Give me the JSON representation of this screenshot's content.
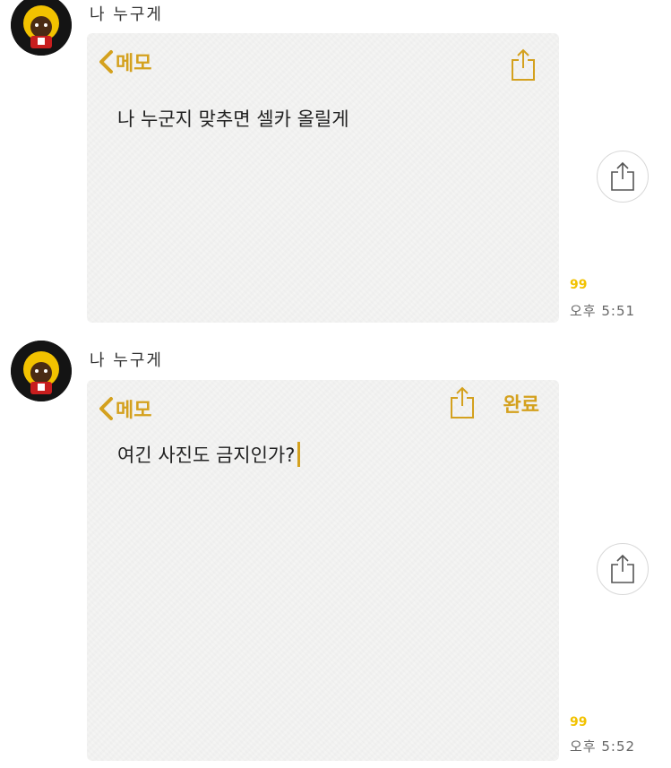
{
  "messages": [
    {
      "sender": "나 누구게",
      "card": {
        "back_label": "메모",
        "text": "나 누군지 맞추면 셀카 올릴게"
      },
      "unread_count": "99",
      "time": "오후 5:51"
    },
    {
      "sender": "나 누구게",
      "card": {
        "back_label": "메모",
        "done_label": "완료",
        "text": "여긴 사진도 금지인가?"
      },
      "unread_count": "99",
      "time": "오후 5:52"
    }
  ],
  "colors": {
    "accent": "#d4a11e",
    "unread": "#f2c200",
    "card_bg": "#f4f4f3"
  },
  "icons": {
    "avatar": "avatar-character-icon",
    "back": "chevron-left-icon",
    "share": "share-icon"
  }
}
